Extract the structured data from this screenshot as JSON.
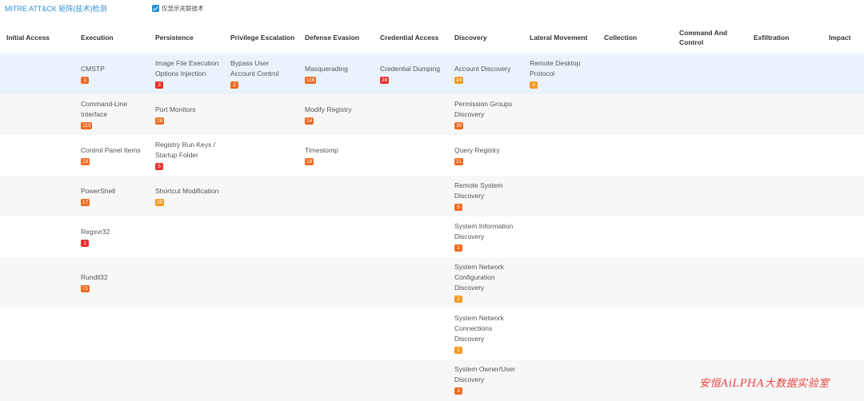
{
  "topbar": {
    "title": "MITRE ATT&CK 矩阵(技术)检测",
    "toggle_label": "仅显示关联技术"
  },
  "columns": [
    "Initial Access",
    "Execution",
    "Persistence",
    "Privilege Escalation",
    "Defense Evasion",
    "Credential Access",
    "Discovery",
    "Lateral Movement",
    "Collection",
    "Command And Control",
    "Exfiltration",
    "Impact"
  ],
  "colors": {
    "red": "#e8302d",
    "orange": "#ee6a22",
    "amber": "#f29b23",
    "link": "#2a8fd6",
    "highlight_row": "#eaf3fb"
  },
  "techniques": {
    "execution": [
      {
        "name": "CMSTP",
        "count": "1"
      },
      {
        "name": "Command-Line Interface",
        "count": "113"
      },
      {
        "name": "Control Panel Items",
        "count": "23"
      },
      {
        "name": "PowerShell",
        "count": "17"
      },
      {
        "name": "Regsvr32",
        "count": "1"
      },
      {
        "name": "Rundll32",
        "count": "71"
      }
    ],
    "persistence": [
      {
        "name": "Image File Execution Options Injection",
        "count": "3"
      },
      {
        "name": "Port Monitors",
        "count": "28"
      },
      {
        "name": "Registry Run Keys / Startup Folder",
        "count": "5"
      },
      {
        "name": "Shortcut Modification",
        "count": "39"
      }
    ],
    "privilege_escalation": [
      {
        "name": "Bypass User Account Control",
        "count": "2"
      }
    ],
    "defense_evasion": [
      {
        "name": "Masquerading",
        "count": "118"
      },
      {
        "name": "Modify Registry",
        "count": "24"
      },
      {
        "name": "Timestomp",
        "count": "19"
      }
    ],
    "credential_access": [
      {
        "name": "Credential Dumping",
        "count": "28"
      }
    ],
    "discovery": [
      {
        "name": "Account Discovery",
        "count": "24"
      },
      {
        "name": "Permission Groups Discovery",
        "count": "30"
      },
      {
        "name": "Query Registry",
        "count": "21"
      },
      {
        "name": "Remote System Discovery",
        "count": "5"
      },
      {
        "name": "System Information Discovery",
        "count": "1"
      },
      {
        "name": "System Network Configuration Discovery",
        "count": "2"
      },
      {
        "name": "System Network Connections Discovery",
        "count": "1"
      },
      {
        "name": "System Owner/User Discovery",
        "count": "3"
      }
    ],
    "lateral_movement": [
      {
        "name": "Remote Desktop Protocol",
        "count": "4"
      }
    ]
  },
  "watermark": "安恒AiLPHA大数据实验室"
}
